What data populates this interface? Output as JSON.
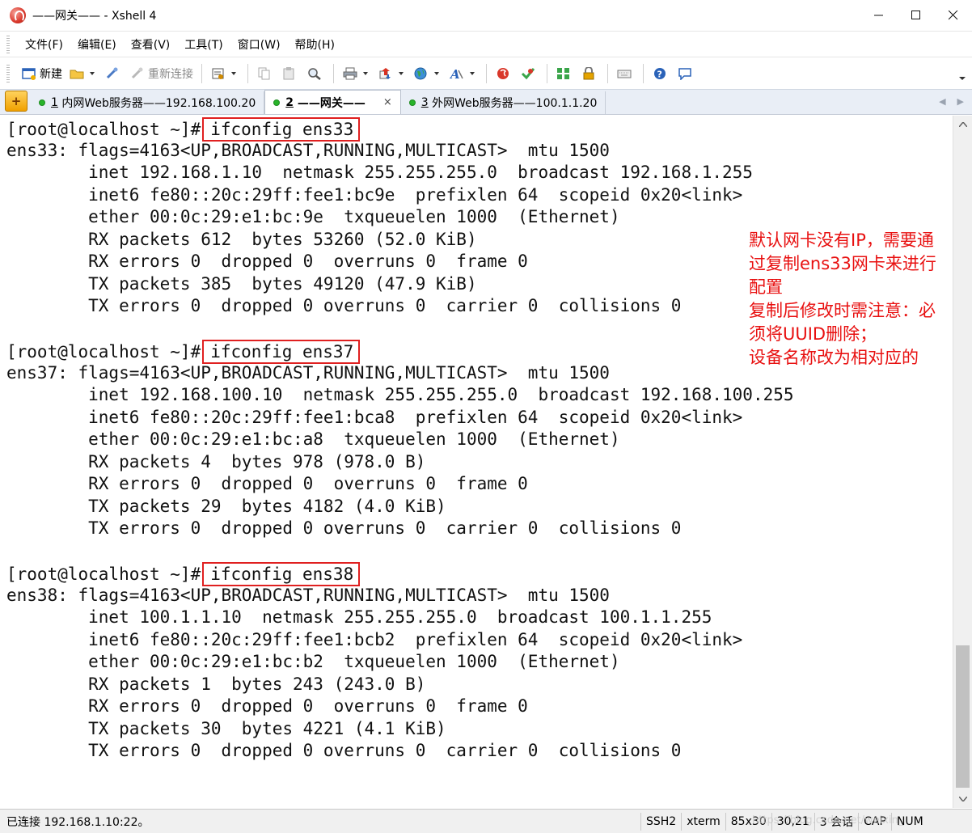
{
  "window": {
    "title": "——网关—— - Xshell 4"
  },
  "menu": [
    "文件(F)",
    "编辑(E)",
    "查看(V)",
    "工具(T)",
    "窗口(W)",
    "帮助(H)"
  ],
  "toolbar": {
    "new_label": "新建",
    "reconnect_label": "重新连接"
  },
  "tabs": [
    {
      "number": "1",
      "label": "内网Web服务器——192.168.100.20",
      "active": false
    },
    {
      "number": "2",
      "label": "——网关——",
      "active": true
    },
    {
      "number": "3",
      "label": "外网Web服务器——100.1.1.20",
      "active": false
    }
  ],
  "tab_close": "×",
  "terminal": {
    "prompt": "[root@localhost ~]#",
    "sections": [
      {
        "command": "ifconfig ens33",
        "lines": [
          "ens33: flags=4163<UP,BROADCAST,RUNNING,MULTICAST>  mtu 1500",
          "        inet 192.168.1.10  netmask 255.255.255.0  broadcast 192.168.1.255",
          "        inet6 fe80::20c:29ff:fee1:bc9e  prefixlen 64  scopeid 0x20<link>",
          "        ether 00:0c:29:e1:bc:9e  txqueuelen 1000  (Ethernet)",
          "        RX packets 612  bytes 53260 (52.0 KiB)",
          "        RX errors 0  dropped 0  overruns 0  frame 0",
          "        TX packets 385  bytes 49120 (47.9 KiB)",
          "        TX errors 0  dropped 0 overruns 0  carrier 0  collisions 0",
          ""
        ]
      },
      {
        "command": "ifconfig ens37",
        "lines": [
          "ens37: flags=4163<UP,BROADCAST,RUNNING,MULTICAST>  mtu 1500",
          "        inet 192.168.100.10  netmask 255.255.255.0  broadcast 192.168.100.255",
          "        inet6 fe80::20c:29ff:fee1:bca8  prefixlen 64  scopeid 0x20<link>",
          "        ether 00:0c:29:e1:bc:a8  txqueuelen 1000  (Ethernet)",
          "        RX packets 4  bytes 978 (978.0 B)",
          "        RX errors 0  dropped 0  overruns 0  frame 0",
          "        TX packets 29  bytes 4182 (4.0 KiB)",
          "        TX errors 0  dropped 0 overruns 0  carrier 0  collisions 0",
          ""
        ]
      },
      {
        "command": "ifconfig ens38",
        "lines": [
          "ens38: flags=4163<UP,BROADCAST,RUNNING,MULTICAST>  mtu 1500",
          "        inet 100.1.1.10  netmask 255.255.255.0  broadcast 100.1.1.255",
          "        inet6 fe80::20c:29ff:fee1:bcb2  prefixlen 64  scopeid 0x20<link>",
          "        ether 00:0c:29:e1:bc:b2  txqueuelen 1000  (Ethernet)",
          "        RX packets 1  bytes 243 (243.0 B)",
          "        RX errors 0  dropped 0  overruns 0  frame 0",
          "        TX packets 30  bytes 4221 (4.1 KiB)",
          "        TX errors 0  dropped 0 overruns 0  carrier 0  collisions 0"
        ]
      }
    ]
  },
  "annotation": {
    "lines": [
      "默认网卡没有IP，需要通",
      "过复制ens33网卡来进行",
      "配置",
      "复制后修改时需注意：必",
      "须将UUID删除；",
      "设备名称改为相对应的"
    ],
    "color": "#e81010"
  },
  "status": {
    "connection": "已连接 192.168.1.10:22。",
    "protocol": "SSH2",
    "terminal_type": "xterm",
    "size": "85x30",
    "cursor": "30,21",
    "sessions": "3 会话",
    "caps": "CAP",
    "num": "NUM"
  },
  "watermark": "https://blog.csdn.net/weixin_"
}
